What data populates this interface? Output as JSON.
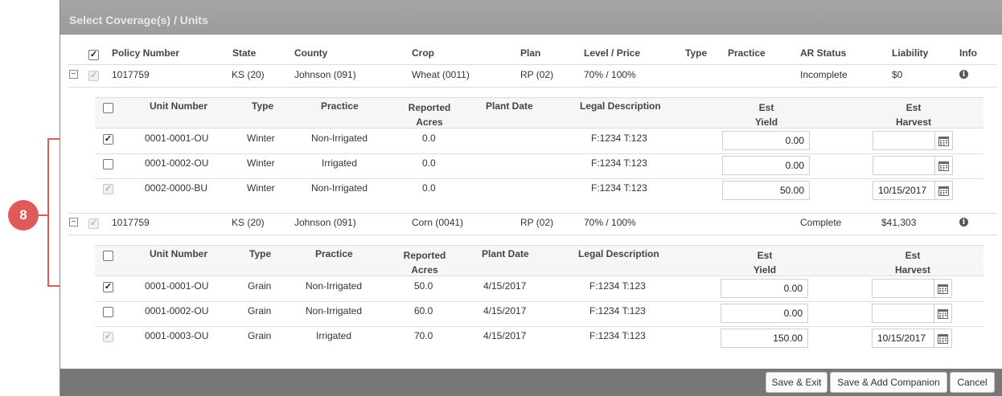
{
  "callout": {
    "number": "8",
    "color": "#e05a5a"
  },
  "dialog": {
    "title": "Select Coverage(s) / Units",
    "buttons": {
      "save_exit": "Save & Exit",
      "save_companion": "Save & Add Companion",
      "cancel": "Cancel"
    }
  },
  "policy_headers": {
    "policy_number": "Policy Number",
    "state": "State",
    "county": "County",
    "crop": "Crop",
    "plan": "Plan",
    "level_price": "Level / Price",
    "type": "Type",
    "practice": "Practice",
    "ar_status": "AR Status",
    "liability": "Liability",
    "info": "Info"
  },
  "unit_headers": {
    "unit_number": "Unit Number",
    "type": "Type",
    "practice": "Practice",
    "reported": "Reported",
    "acres": "Acres",
    "plant_date": "Plant Date",
    "legal_description": "Legal Description",
    "est": "Est",
    "yield": "Yield",
    "harvest": "Harvest"
  },
  "policies": [
    {
      "policy_number": "1017759",
      "state": "KS (20)",
      "county": "Johnson (091)",
      "crop": "Wheat (0011)",
      "plan": "RP (02)",
      "level_price": "70% / 100%",
      "type": "",
      "practice": "",
      "ar_status": "Incomplete",
      "liability": "$0",
      "units": [
        {
          "checked": true,
          "disabled": false,
          "unit_number": "0001-0001-OU",
          "type": "Winter",
          "practice": "Non-Irrigated",
          "acres": "0.0",
          "plant_date": "",
          "legal": "F:1234 T:123",
          "yield": "0.00",
          "harvest": ""
        },
        {
          "checked": false,
          "disabled": false,
          "unit_number": "0001-0002-OU",
          "type": "Winter",
          "practice": "Irrigated",
          "acres": "0.0",
          "plant_date": "",
          "legal": "F:1234 T:123",
          "yield": "0.00",
          "harvest": ""
        },
        {
          "checked": true,
          "disabled": true,
          "unit_number": "0002-0000-BU",
          "type": "Winter",
          "practice": "Non-Irrigated",
          "acres": "0.0",
          "plant_date": "",
          "legal": "F:1234 T:123",
          "yield": "50.00",
          "harvest": "10/15/2017"
        }
      ]
    },
    {
      "policy_number": "1017759",
      "state": "KS (20)",
      "county": "Johnson (091)",
      "crop": "Corn (0041)",
      "plan": "RP (02)",
      "level_price": "70% / 100%",
      "type": "",
      "practice": "",
      "ar_status": "Complete",
      "liability": "$41,303",
      "units": [
        {
          "checked": true,
          "disabled": false,
          "unit_number": "0001-0001-OU",
          "type": "Grain",
          "practice": "Non-Irrigated",
          "acres": "50.0",
          "plant_date": "4/15/2017",
          "legal": "F:1234 T:123",
          "yield": "0.00",
          "harvest": ""
        },
        {
          "checked": false,
          "disabled": false,
          "unit_number": "0001-0002-OU",
          "type": "Grain",
          "practice": "Non-Irrigated",
          "acres": "60.0",
          "plant_date": "4/15/2017",
          "legal": "F:1234 T:123",
          "yield": "0.00",
          "harvest": ""
        },
        {
          "checked": true,
          "disabled": true,
          "unit_number": "0001-0003-OU",
          "type": "Grain",
          "practice": "Irrigated",
          "acres": "70.0",
          "plant_date": "4/15/2017",
          "legal": "F:1234 T:123",
          "yield": "150.00",
          "harvest": "10/15/2017"
        }
      ]
    }
  ]
}
